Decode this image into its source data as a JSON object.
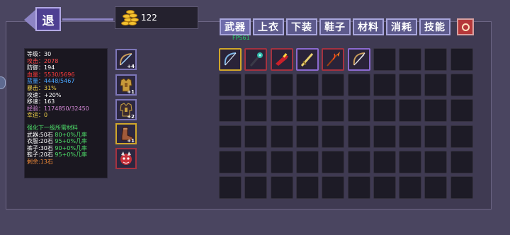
{
  "header": {
    "back_label": "退",
    "gold": "122"
  },
  "tabs": [
    {
      "label": "武器"
    },
    {
      "label": "上衣"
    },
    {
      "label": "下装"
    },
    {
      "label": "鞋子"
    },
    {
      "label": "材料"
    },
    {
      "label": "消耗"
    },
    {
      "label": "技能"
    }
  ],
  "fps": "FPS61",
  "stats": [
    {
      "text": "等级：30",
      "color": "#ffffff"
    },
    {
      "text": "攻击：2078",
      "color": "#ff4a4a"
    },
    {
      "text": "防御：194",
      "color": "#ffffff"
    },
    {
      "text": "血量：5530/5696",
      "color": "#ff3c3c"
    },
    {
      "text": "蓝量：4448/5467",
      "color": "#4aa6ff"
    },
    {
      "text": "暴击：31%",
      "color": "#f3d34a"
    },
    {
      "text": "攻速：+20%",
      "color": "#ffffff"
    },
    {
      "text": "移速：163",
      "color": "#ffffff"
    },
    {
      "text": "经验：1174850/32450",
      "color": "#d68ad8"
    },
    {
      "text": "幸运：0",
      "color": "#f3d34a"
    }
  ],
  "upgrade": {
    "title": "强化下一级所需材料",
    "lines": [
      {
        "label": "武器:50石",
        "pct": "80+0%几率"
      },
      {
        "label": "衣服:20石",
        "pct": "95+0%几率"
      },
      {
        "label": "裤子:30石",
        "pct": "90+0%几率"
      },
      {
        "label": "鞋子:20石",
        "pct": "95+0%几率"
      }
    ],
    "remaining": "剩余:13石"
  },
  "equipment": [
    {
      "slot": "weapon",
      "icon": "bow-icon",
      "level": "+4"
    },
    {
      "slot": "top",
      "icon": "gold-armor-icon",
      "level": "+1"
    },
    {
      "slot": "pants",
      "icon": "dark-armor-icon",
      "level": "+2"
    },
    {
      "slot": "shoes",
      "icon": "boot-icon",
      "level": "+1"
    },
    {
      "slot": "pet",
      "icon": "demon-pet-icon",
      "level": ""
    }
  ],
  "inventory": [
    {
      "icon": "blue-bow-icon",
      "rarity": "gold"
    },
    {
      "icon": "dark-staff-icon",
      "rarity": "red"
    },
    {
      "icon": "red-gun-icon",
      "rarity": "red"
    },
    {
      "icon": "gold-sword-icon",
      "rarity": "purple"
    },
    {
      "icon": "flame-spear-icon",
      "rarity": "red"
    },
    {
      "icon": "bow-icon",
      "rarity": "purple"
    }
  ],
  "grid_size": {
    "cols": 10,
    "rows": 6
  },
  "colors": {
    "label_white": "#ffffff",
    "green": "#4ee06a",
    "orange": "#f08a38",
    "gold_text": "#f3d34a"
  }
}
